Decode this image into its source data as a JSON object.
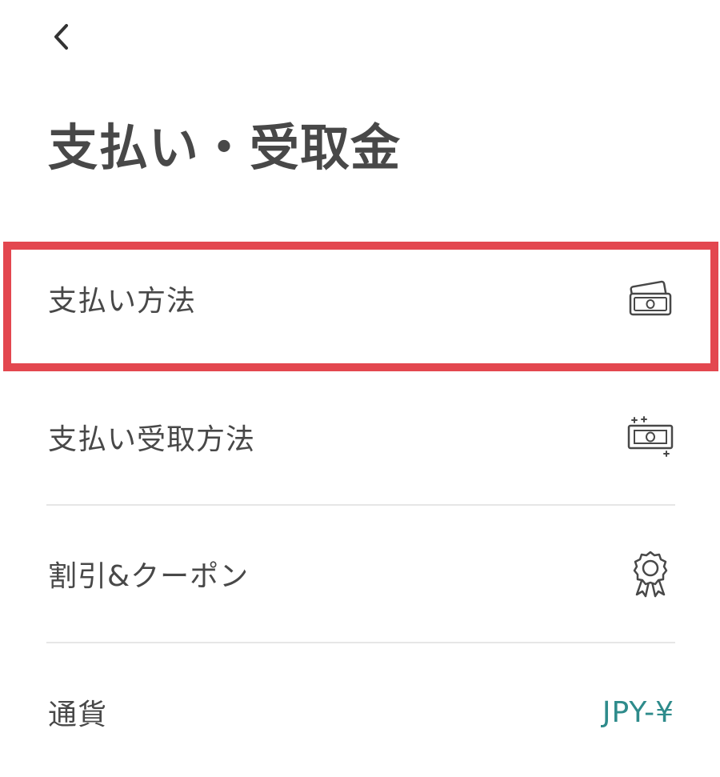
{
  "header": {
    "back_icon": "chevron-left-icon",
    "title": "支払い・受取金"
  },
  "menu": {
    "items": [
      {
        "label": "支払い方法",
        "icon": "cards-icon"
      },
      {
        "label": "支払い受取方法",
        "icon": "cash-sparkle-icon"
      },
      {
        "label": "割引&クーポン",
        "icon": "award-ribbon-icon"
      },
      {
        "label": "通貨",
        "value": "JPY-¥"
      }
    ]
  },
  "highlight": {
    "target": "支払い方法",
    "color": "#e3474f"
  },
  "colors": {
    "text": "#484848",
    "accent": "#2e8b8b",
    "divider": "#e6e6e6"
  }
}
